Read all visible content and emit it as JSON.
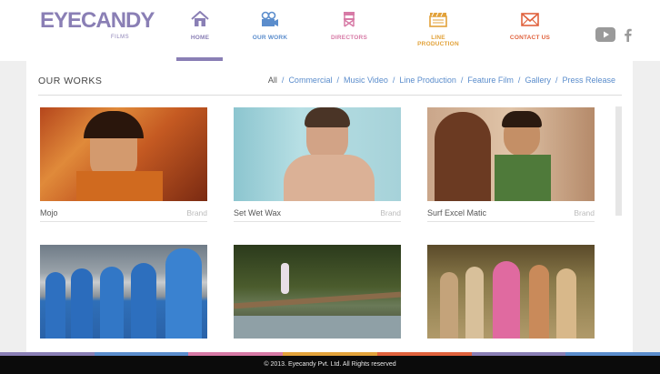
{
  "brand": {
    "logo_text": "EYECANDY",
    "logo_sub": "FILMS",
    "color": "#8a7fb5"
  },
  "nav": [
    {
      "label": "HOME",
      "icon": "home-icon",
      "color": "#8a7fb5"
    },
    {
      "label": "OUR WORK",
      "icon": "video-camera-icon",
      "color": "#5b8dcc"
    },
    {
      "label": "DIRECTORS",
      "icon": "director-chair-icon",
      "color": "#d77aa6"
    },
    {
      "label": "LINE PRODUCTION",
      "icon": "clapperboard-icon",
      "color": "#e2a23a"
    },
    {
      "label": "CONTACT US",
      "icon": "envelope-icon",
      "color": "#e0623d"
    }
  ],
  "social": [
    {
      "icon": "youtube-icon"
    },
    {
      "icon": "facebook-icon"
    }
  ],
  "works": {
    "title": "OUR WORKS",
    "filters": [
      "All",
      "Commercial",
      "Music Video",
      "Line Production",
      "Feature Film",
      "Gallery",
      "Press Release"
    ],
    "items": [
      {
        "title": "Mojo",
        "brand": "Brand"
      },
      {
        "title": "Set Wet Wax",
        "brand": "Brand"
      },
      {
        "title": "Surf Excel Matic",
        "brand": "Brand"
      },
      {
        "title": "",
        "brand": ""
      },
      {
        "title": "",
        "brand": ""
      },
      {
        "title": "",
        "brand": ""
      }
    ]
  },
  "footer": {
    "text": "© 2013. Eyecandy Pvt. Ltd. All Rights reserved"
  },
  "stripe_colors": [
    "#8a7fb5",
    "#5b8dcc",
    "#d77aa6",
    "#e2a23a",
    "#e0623d",
    "#8a7fb5",
    "#5b8dcc"
  ]
}
